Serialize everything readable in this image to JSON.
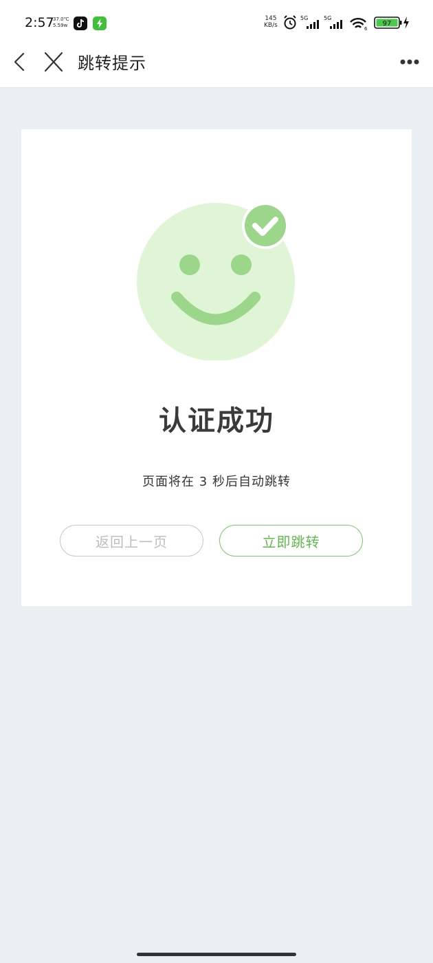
{
  "status_bar": {
    "time": "2:57",
    "temperature": "37.0℃",
    "power": "5.59w",
    "app_icons": [
      "tiktok-icon",
      "green-bolt-app-icon"
    ],
    "net_speed_value": "145",
    "net_speed_unit": "KB/s",
    "sim1_label": "5G",
    "sim2_label": "5G",
    "wifi_label": "6",
    "battery_level": "97",
    "charging": true,
    "icons": [
      "alarm-icon",
      "signal-icon",
      "signal-icon",
      "wifi-icon",
      "battery-icon",
      "charging-icon"
    ]
  },
  "title_bar": {
    "title": "跳转提示",
    "icons": [
      "back-arrow-icon",
      "close-icon",
      "more-icon"
    ]
  },
  "card": {
    "illustration": "smiley-face-with-checkmark",
    "headline": "认证成功",
    "countdown_text": "页面将在 3 秒后自动跳转",
    "back_button_label": "返回上一页",
    "go_button_label": "立即跳转"
  },
  "colors": {
    "accent_green": "#5fb94c",
    "face_fill": "#dff5d6",
    "face_features": "#9bd68a",
    "page_background": "#eceff1"
  }
}
